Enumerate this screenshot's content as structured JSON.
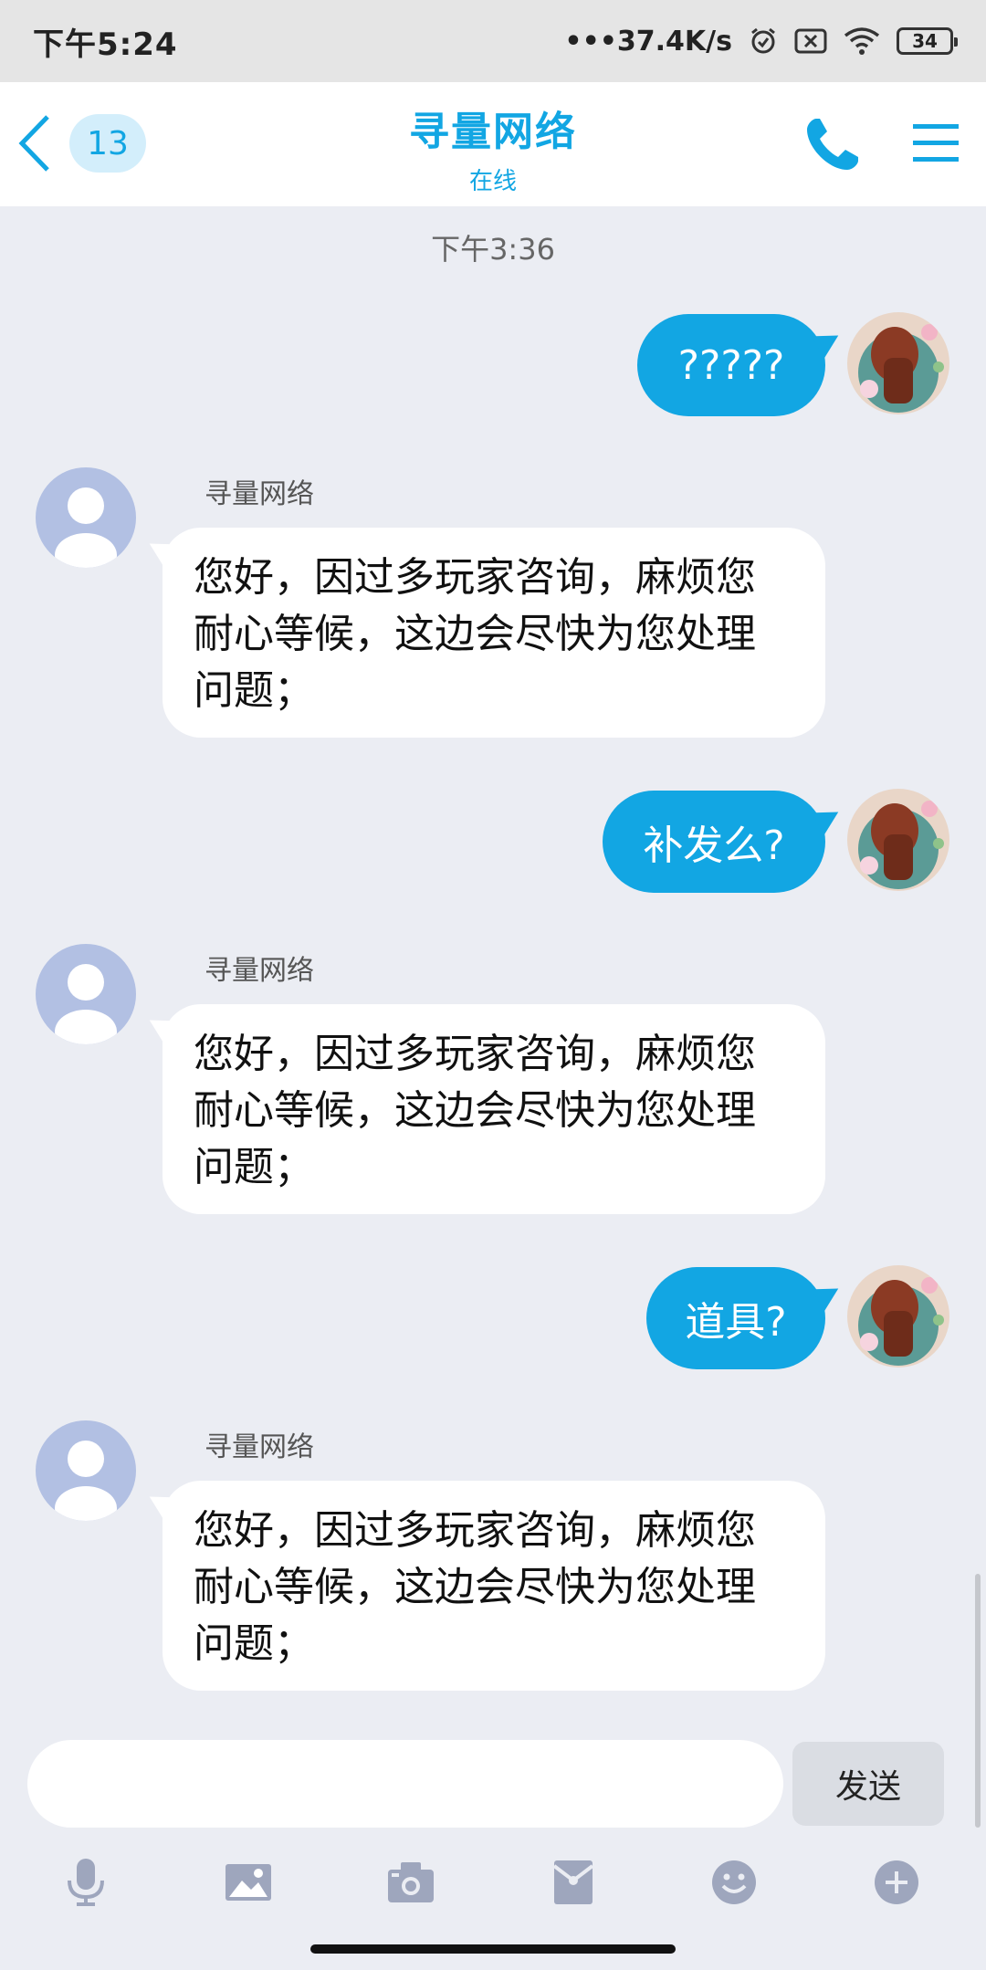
{
  "status_bar": {
    "time": "下午5:24",
    "network_speed": "•••37.4K/s",
    "battery": "34",
    "icons": [
      "alarm-icon",
      "sim-off-icon",
      "wifi-icon",
      "battery-icon"
    ]
  },
  "header": {
    "unread_count": "13",
    "title": "寻量网络",
    "subtitle": "在线",
    "icons": [
      "back-arrow-icon",
      "phone-icon",
      "menu-icon"
    ]
  },
  "chat": {
    "timestamp": "下午3:36",
    "messages": [
      {
        "direction": "out",
        "text": "?????"
      },
      {
        "direction": "in",
        "sender": "寻量网络",
        "lines": [
          "您好，因过多玩家咨询，麻烦您",
          "耐心等候，这边会尽快为您处理",
          "问题；"
        ]
      },
      {
        "direction": "out",
        "text": "补发么?"
      },
      {
        "direction": "in",
        "sender": "寻量网络",
        "lines": [
          "您好，因过多玩家咨询，麻烦您",
          "耐心等候，这边会尽快为您处理",
          "问题；"
        ]
      },
      {
        "direction": "out",
        "text": "道具?"
      },
      {
        "direction": "in",
        "sender": "寻量网络",
        "lines": [
          "您好，因过多玩家咨询，麻烦您",
          "耐心等候，这边会尽快为您处理",
          "问题；"
        ]
      }
    ]
  },
  "composer": {
    "input_value": "",
    "send_label": "发送"
  },
  "toolbar": {
    "items": [
      "microphone-icon",
      "image-icon",
      "camera-icon",
      "red-packet-icon",
      "emoji-icon",
      "plus-icon"
    ]
  },
  "colors": {
    "accent": "#12a6e3",
    "background": "#ebedf3",
    "header_bg": "#ffffff",
    "bubble_in": "#ffffff",
    "avatar_default": "#b2c0e3",
    "toolbar_icon": "#9ea6bd"
  }
}
